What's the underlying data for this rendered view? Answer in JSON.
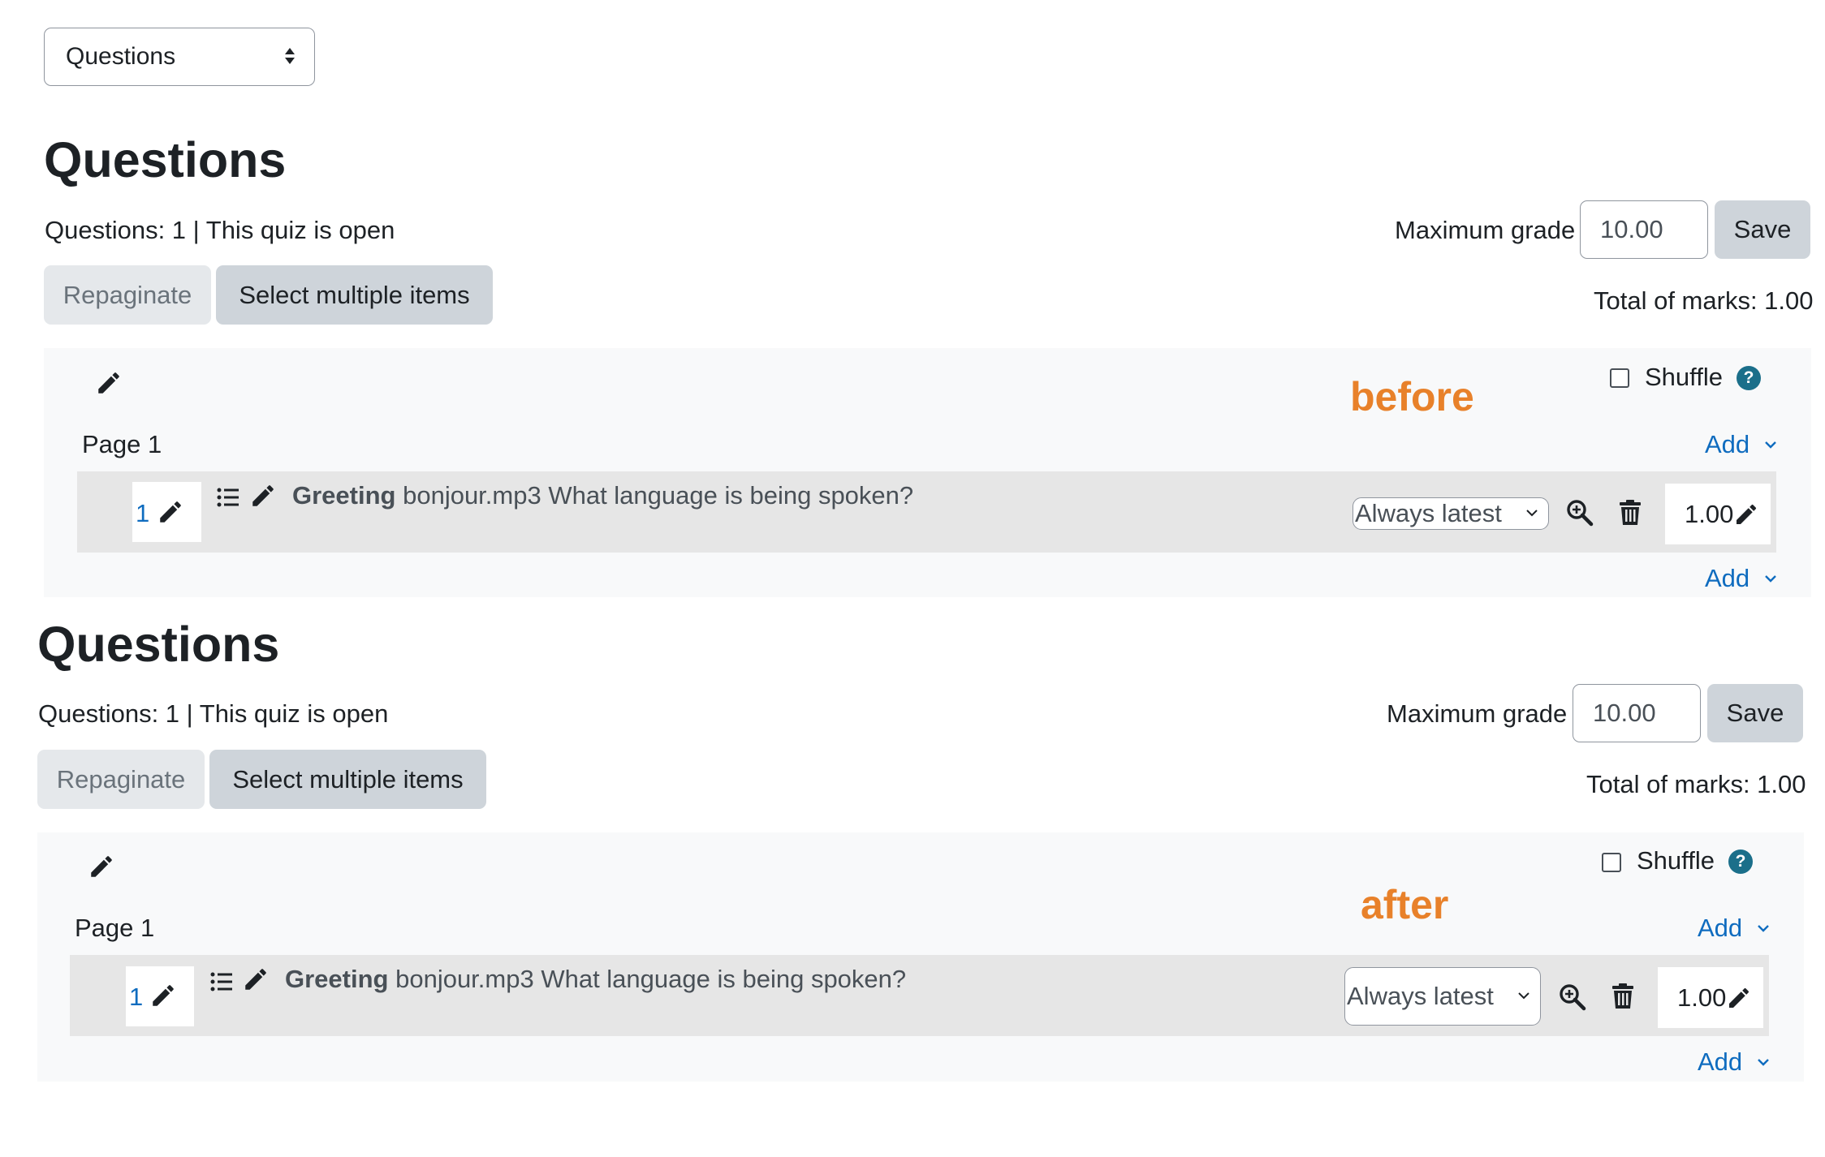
{
  "top_select": {
    "value": "Questions"
  },
  "sections": [
    {
      "heading": "Questions",
      "status": "Questions: 1 | This quiz is open",
      "repaginate_label": "Repaginate",
      "select_multiple_label": "Select multiple items",
      "max_grade_label": "Maximum grade",
      "max_grade_value": "10.00",
      "save_label": "Save",
      "total_marks": "Total of marks: 1.00",
      "annotation": "before",
      "shuffle_label": "Shuffle",
      "help_glyph": "?",
      "page_label": "Page 1",
      "add_label": "Add",
      "question": {
        "number": "1",
        "name": "Greeting",
        "text": "bonjour.mp3 What language is being spoken?",
        "version": "Always latest",
        "mark": "1.00"
      }
    },
    {
      "heading": "Questions",
      "status": "Questions: 1 | This quiz is open",
      "repaginate_label": "Repaginate",
      "select_multiple_label": "Select multiple items",
      "max_grade_label": "Maximum grade",
      "max_grade_value": "10.00",
      "save_label": "Save",
      "total_marks": "Total of marks: 1.00",
      "annotation": "after",
      "shuffle_label": "Shuffle",
      "help_glyph": "?",
      "page_label": "Page 1",
      "add_label": "Add",
      "question": {
        "number": "1",
        "name": "Greeting",
        "text": "bonjour.mp3 What language is being spoken?",
        "version": "Always latest",
        "mark": "1.00"
      }
    }
  ],
  "icons": [
    "pencil-icon",
    "list-icon",
    "search-icon",
    "trash-icon",
    "chevron-down-icon",
    "updown-arrows-icon"
  ],
  "colors": {
    "link": "#0f6cbf",
    "annotation": "#e8812a",
    "help": "#1b6f8a",
    "button": "#ced4da"
  }
}
